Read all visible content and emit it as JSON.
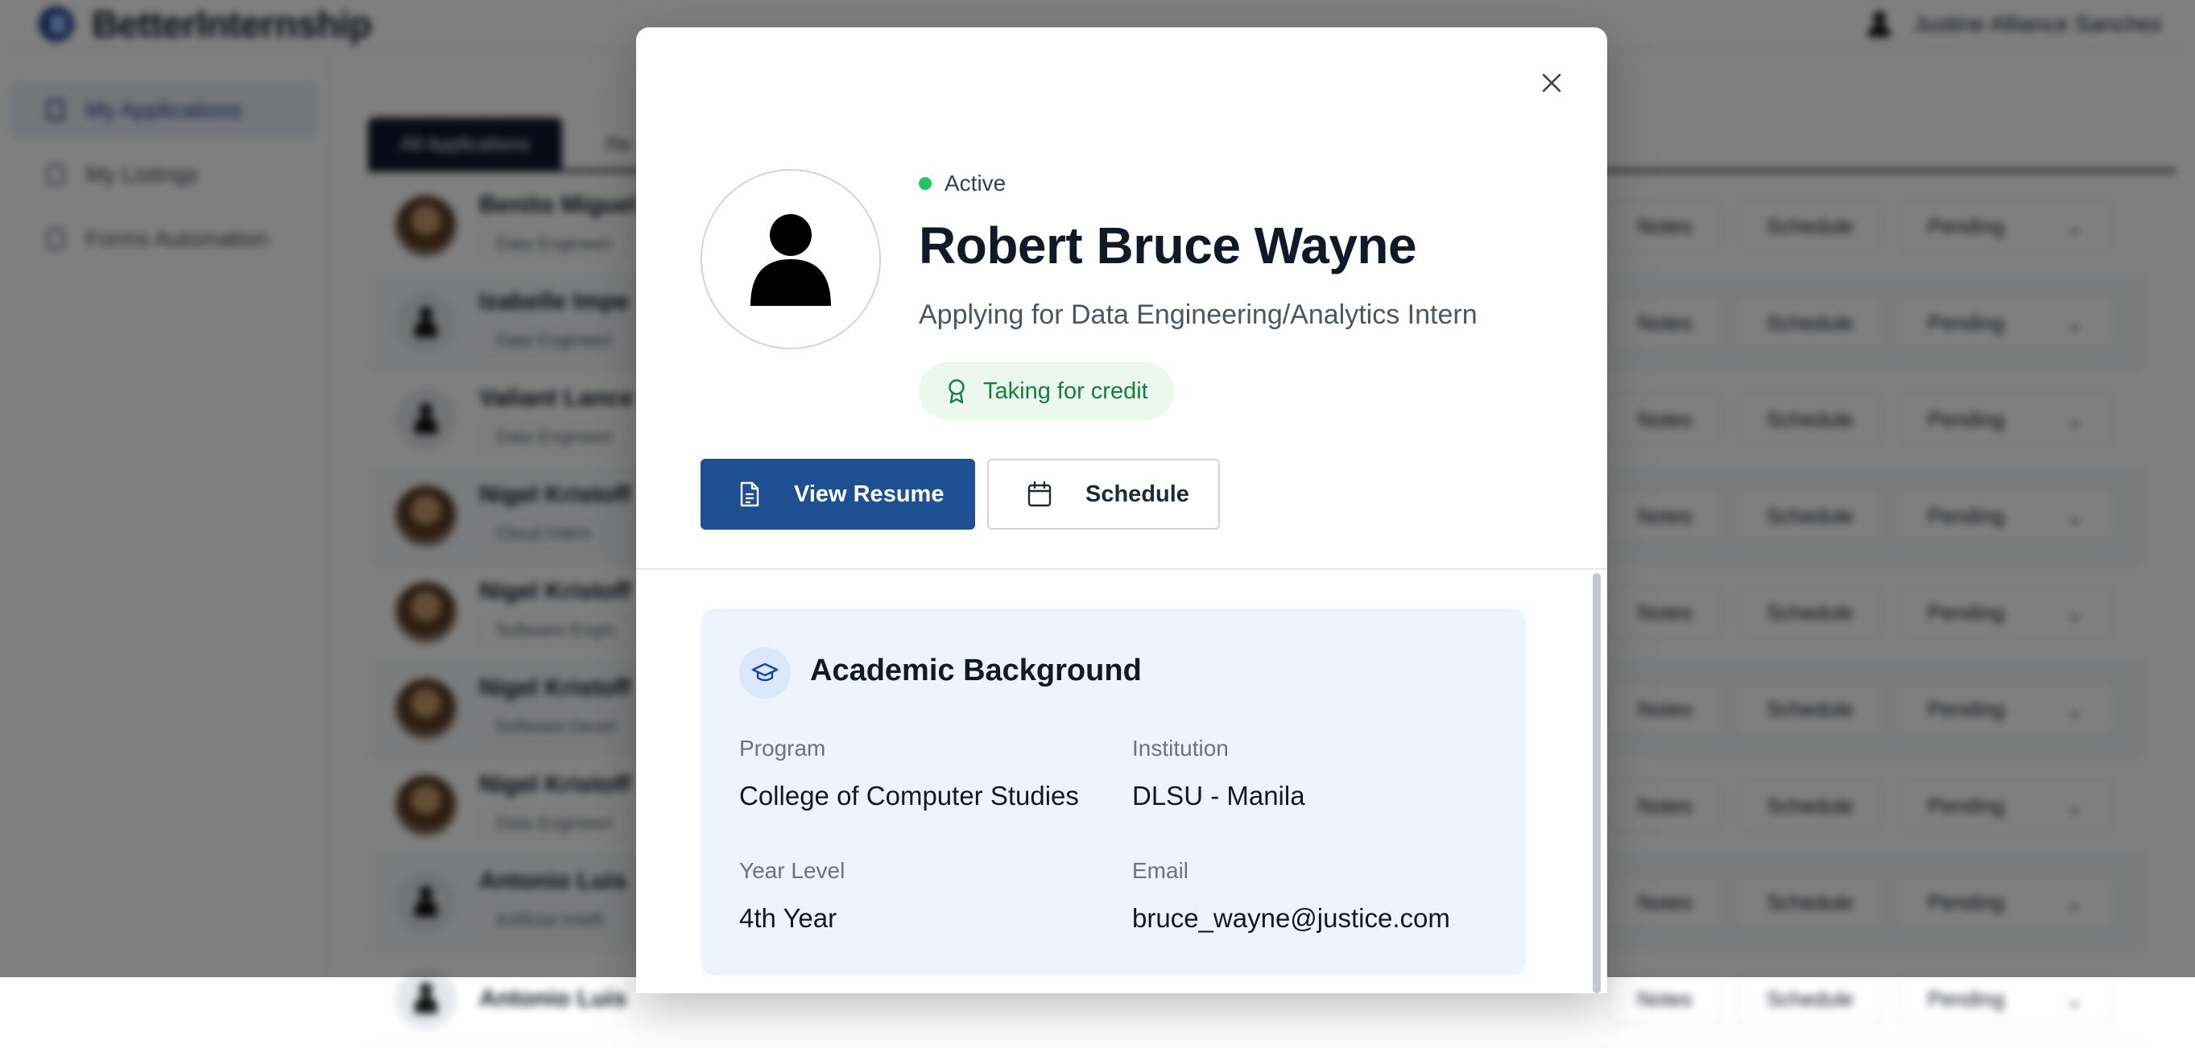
{
  "app": {
    "brand": "BetterInternship",
    "user_name": "Justine Alliance Sanchez"
  },
  "sidebar": {
    "items": [
      {
        "label": "My Applications"
      },
      {
        "label": "My Listings"
      },
      {
        "label": "Forms Automation"
      }
    ]
  },
  "tabs": [
    {
      "label": "All Applications"
    },
    {
      "label": "Re"
    }
  ],
  "applications": {
    "rows": [
      {
        "name": "Benito Miguel",
        "role": "Data Engineeri",
        "avatar": "photo"
      },
      {
        "name": "Izabelle Impe",
        "role": "Data Engineeri",
        "avatar": "blank"
      },
      {
        "name": "Valiant Lance",
        "role": "Data Engineeri",
        "avatar": "blank"
      },
      {
        "name": "Nigel Kristoff",
        "role": "Cloud Intern",
        "avatar": "photo"
      },
      {
        "name": "Nigel Kristoff",
        "role": "Software Engin",
        "avatar": "photo"
      },
      {
        "name": "Nigel Kristoff",
        "role": "Software Devel",
        "avatar": "photo"
      },
      {
        "name": "Nigel Kristoff",
        "role": "Data Engineeri",
        "avatar": "photo"
      },
      {
        "name": "Antonio Luis",
        "role": "Artificial Intelli",
        "avatar": "blank"
      },
      {
        "name": "Antonio Luis",
        "role": "",
        "avatar": "blank"
      }
    ],
    "notes_label": "Notes",
    "schedule_label": "Schedule",
    "status_label": "Pending"
  },
  "modal": {
    "status": "Active",
    "status_color": "#22c55e",
    "name": "Robert Bruce Wayne",
    "applying_for": "Applying for Data Engineering/Analytics Intern",
    "credit_badge": "Taking for credit",
    "view_resume_label": "View Resume",
    "schedule_label": "Schedule",
    "primary_color": "#1f4f93",
    "academic": {
      "title": "Academic Background",
      "program_label": "Program",
      "program_value": "College of Computer Studies",
      "institution_label": "Institution",
      "institution_value": "DLSU - Manila",
      "year_label": "Year Level",
      "year_value": "4th Year",
      "email_label": "Email",
      "email_value": "bruce_wayne@justice.com"
    }
  }
}
